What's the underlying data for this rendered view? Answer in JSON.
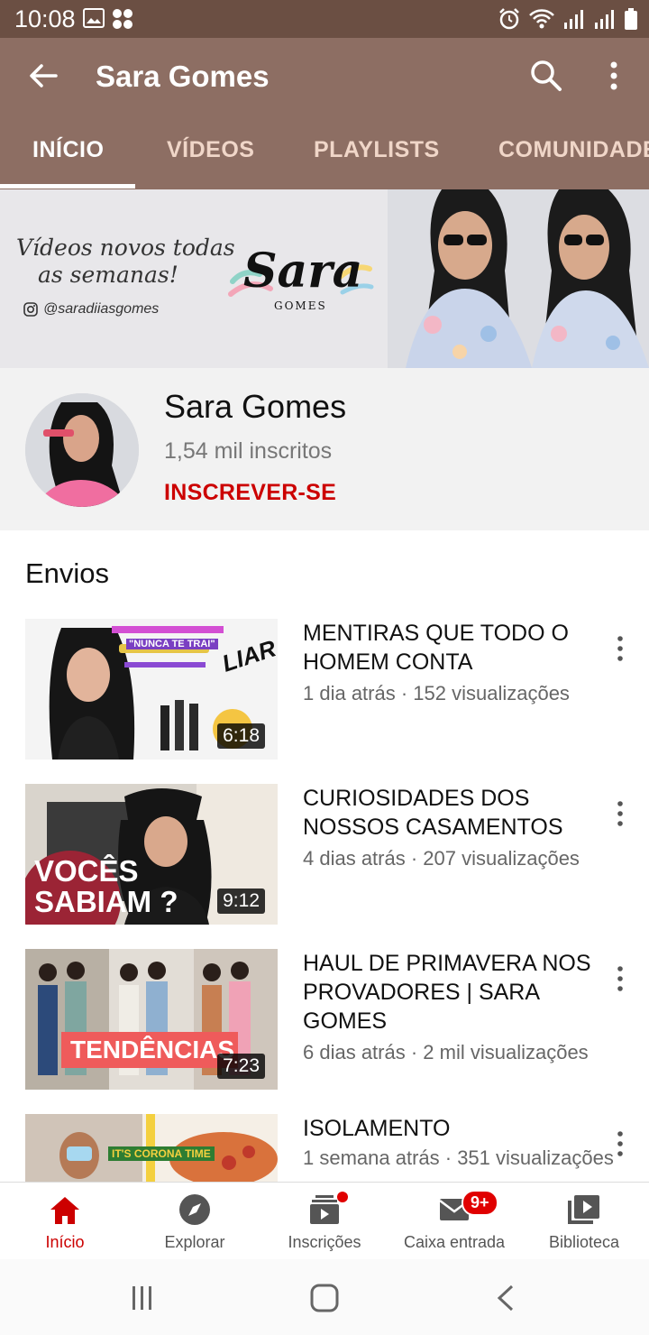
{
  "status_bar": {
    "time": "10:08"
  },
  "app_bar": {
    "title": "Sara Gomes"
  },
  "tabs": [
    {
      "label": "INÍCIO",
      "active": true
    },
    {
      "label": "VÍDEOS",
      "active": false
    },
    {
      "label": "PLAYLISTS",
      "active": false
    },
    {
      "label": "COMUNIDADE",
      "active": false
    }
  ],
  "banner": {
    "slogan_line1": "Vídeos novos todas",
    "slogan_line2": "as semanas!",
    "handle": "@saradiiasgomes",
    "logo": "Sara",
    "logo_sub": "GOMES"
  },
  "channel": {
    "name": "Sara Gomes",
    "subscribers": "1,54 mil inscritos",
    "subscribe_label": "INSCREVER-SE"
  },
  "uploads": {
    "title": "Envios",
    "videos": [
      {
        "title": "MENTIRAS QUE TODO O HOMEM CONTA",
        "meta": "1 dia atrás · 152 visualizações",
        "duration": "6:18",
        "thumb_text": "LIAR",
        "thumb_text2": "\"NUNCA TE TRAI\""
      },
      {
        "title": "CURIOSIDADES DOS NOSSOS CASAMENTOS",
        "meta": "4 dias atrás · 207 visualizações",
        "duration": "9:12",
        "thumb_text": "VOCÊS",
        "thumb_text2": "SABIAM ?"
      },
      {
        "title": "HAUL DE PRIMAVERA NOS PROVADORES | SARA GOMES",
        "meta": "6 dias atrás · 2 mil visualizações",
        "duration": "7:23",
        "thumb_text": "TENDÊNCIAS"
      },
      {
        "title": "ISOLAMENTO",
        "meta": "1 semana atrás · 351 visualizações",
        "duration": "",
        "thumb_text": "IT'S CORONA TIME"
      }
    ]
  },
  "bottom_nav": [
    {
      "label": "Início",
      "icon": "home-icon",
      "active": true
    },
    {
      "label": "Explorar",
      "icon": "compass-icon",
      "active": false
    },
    {
      "label": "Inscrições",
      "icon": "subscriptions-icon",
      "active": false,
      "dot": true
    },
    {
      "label": "Caixa entrada",
      "icon": "mail-icon",
      "active": false,
      "badge": "9+"
    },
    {
      "label": "Biblioteca",
      "icon": "library-icon",
      "active": false
    }
  ],
  "colors": {
    "app_bar": "#8d6e63",
    "status_bar": "#6b4f43",
    "accent": "#cc0000"
  }
}
